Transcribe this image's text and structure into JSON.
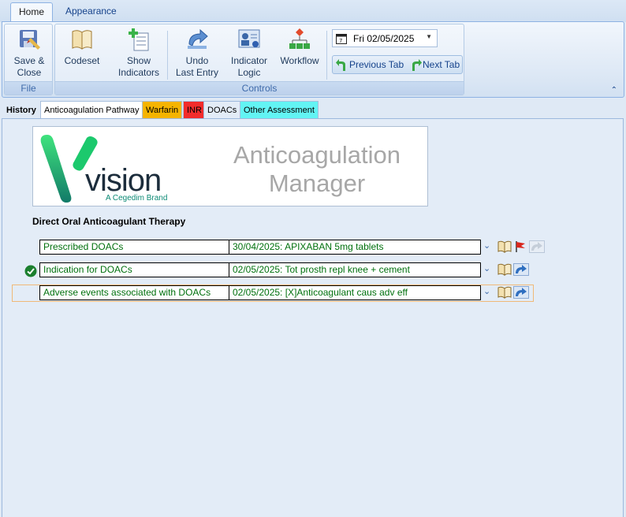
{
  "ribbon_tabs": [
    {
      "label": "Home"
    },
    {
      "label": "Appearance"
    }
  ],
  "ribbon": {
    "groups": {
      "file": "File",
      "controls": "Controls"
    },
    "buttons": {
      "save_close": [
        "Save &",
        "Close"
      ],
      "codeset": "Codeset",
      "show_indicators": [
        "Show",
        "Indicators"
      ],
      "undo": [
        "Undo",
        "Last Entry"
      ],
      "indicator_logic": [
        "Indicator",
        "Logic"
      ],
      "workflow": "Workflow"
    },
    "date": "Fri 02/05/2025",
    "previous_tab": "Previous Tab",
    "next_tab": "Next Tab"
  },
  "page_tabs": [
    {
      "label": "History",
      "color": "#dfe9f5",
      "bold": true
    },
    {
      "label": "Anticoagulation Pathway",
      "color": "#ffffff"
    },
    {
      "label": "Warfarin",
      "color": "#f5b400"
    },
    {
      "label": "INR",
      "color": "#f22c2c"
    },
    {
      "label": "DOACs",
      "color": "#e3ecf7"
    },
    {
      "label": "Other Assessment",
      "color": "#62f4f4"
    }
  ],
  "banner": {
    "brand": "vision",
    "brand_sub": "A Cegedim Brand",
    "title_line1": "Anticoagulation",
    "title_line2": "Manager"
  },
  "section_title": "Direct Oral Anticoagulant Therapy",
  "rows": [
    {
      "label": "Prescribed DOACs",
      "value": "30/04/2025: APIXABAN 5mg tablets"
    },
    {
      "label": "Indication for DOACs",
      "value": "02/05/2025: Tot prosth repl knee + cement"
    },
    {
      "label": "Adverse events associated with DOACs",
      "value": "02/05/2025: [X]Anticoagulant caus adv eff"
    }
  ],
  "colors": {
    "field_text": "#00700d",
    "accent": "#15428b"
  }
}
